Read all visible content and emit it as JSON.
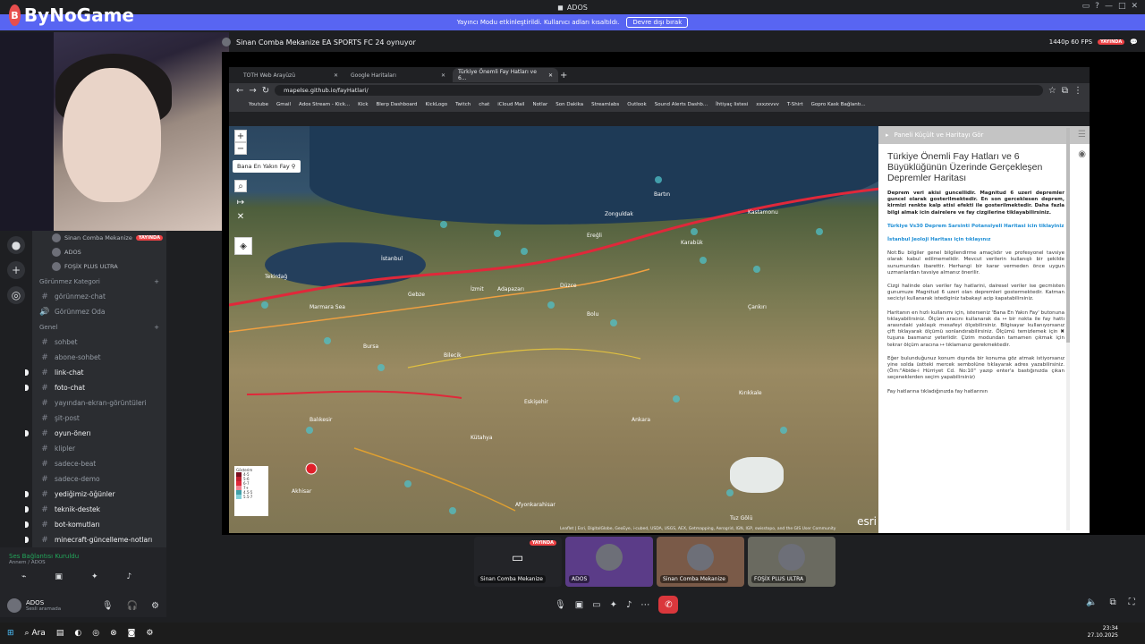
{
  "window": {
    "title": "ADOS"
  },
  "banner": {
    "text": "Yayıncı Modu etkinleştirildi. Kullanıcı adları kısaltıldı.",
    "button": "Devre dışı bırak"
  },
  "logo": {
    "text": "ByNoGame"
  },
  "voice_users": [
    {
      "name": "Sinan Comba Mekanize",
      "live": "YAYINDA"
    },
    {
      "name": "ADOS"
    },
    {
      "name": "FOŞİX PLUS ULTRA"
    }
  ],
  "categories": {
    "hidden": "Görünmez Kategori",
    "general": "Genel"
  },
  "hidden_channels": [
    "görünmez-chat",
    "Görünmez Oda"
  ],
  "channels": [
    "sohbet",
    "abone-sohbet",
    "link-chat",
    "foto-chat",
    "yayından-ekran-görüntüleri",
    "şit-post",
    "oyun-önerı",
    "klipler",
    "sadece-beat",
    "sadece-demo",
    "yediğimiz-öğünler",
    "teknik-destek",
    "bot-komutları",
    "minecraft-güncelleme-notları"
  ],
  "unread_channels": [
    "link-chat",
    "foto-chat",
    "oyun-önerı",
    "yediğimiz-öğünler",
    "teknik-destek",
    "bot-komutları",
    "minecraft-güncelleme-notları"
  ],
  "voice_status": {
    "title": "Ses Bağlantısı Kuruldu",
    "sub": "Annem / ADOS"
  },
  "user": {
    "name": "ADOS",
    "status": "Sesli aramada"
  },
  "stream": {
    "title": "Sinan Comba Mekanize EA SPORTS FC 24 oynuyor",
    "quality": "1440p 60 FPS",
    "live": "YAYINDA"
  },
  "browser": {
    "tabs": [
      "TOTH Web Arayüzü",
      "Google Haritaları",
      "Türkiye Önemli Fay Hatları ve 6..."
    ],
    "url": "mapelse.github.io/fayHatlari/",
    "bookmarks": [
      "Youtube",
      "Gmail",
      "Ados Stream - Kick...",
      "Kick",
      "Blerp Dashboard",
      "KickLogo",
      "Twitch",
      "chat",
      "iCloud Mail",
      "Notlar",
      "Son Dakika",
      "Streamlabs",
      "Outlook",
      "Sound Alerts Dashb...",
      "İhtiyaç listesi",
      "xxxzxvvv",
      "T-Shirt",
      "Gopro Kask Bağlantı..."
    ]
  },
  "map": {
    "near_button": "Bana En Yakın Fay",
    "attribution": "Leaflet | Esri, DigitalGlobe, GeoEye, i-cubed, USDA, USGS, AEX, Getmapping, Aerogrid, IGN, IGP, swisstopo, and the GIS User Community",
    "esri": "esri",
    "legend_title": "Gösterim",
    "legend_items": [
      "4-5",
      "5-6",
      "6-7",
      "7+",
      "4.5-5",
      "5.5-7"
    ],
    "cities": [
      "Bartın",
      "Zonguldak",
      "Kastamonu",
      "Ereğli",
      "Karabük",
      "İstanbul",
      "Tekirdağ",
      "Gebze",
      "İzmit",
      "Adapazarı",
      "Düzce",
      "Bolu",
      "Çankırı",
      "Bursa",
      "Bilecik",
      "Kütahya",
      "Eskişehir",
      "Ankara",
      "Kırıkkale",
      "Balıkesir",
      "Akhisar",
      "Afyonkarahisar",
      "Tuz Gölü",
      "Marmara Sea"
    ]
  },
  "panel": {
    "header": "Paneli Küçült ve Haritayı Gör",
    "title": "Türkiye Önemli Fay Hatları ve 6 Büyüklüğünün Üzerinde Gerçekleşen Depremler Haritası",
    "note_bold": "Deprem veri akisi guncellidir. Magnitud 6 uzeri depremler guncel olarak gosterilmektedir. En son gerceklesen deprem, kirmizi renkte kalp atisi efekti ile gosterilmektedir. Daha fazla bilgi almak icin dairelere ve fay cizgilerine tiklayabilirsiniz.",
    "link1": "Türkiye Vs30 Deprem Sarsinti Potansiyeli Haritasi icin tiklayiniz",
    "link2": "İstanbul Jeoloji Haritası için tıklayınız",
    "p1": "Not:Bu bilgiler genel bilgilendirme amaçlıdır ve profesyonel tavsiye olarak kabul edilmemelidir. Mevcut verilerin kullanışlı bir şekilde sunumundan ibarettir. Herhangi bir karar vermeden önce uygun uzmanlardan tavsiye almanız önerilir.",
    "p2": "Cizgi halinde olan veriler fay hatlarini, dairesel veriler ise gecmisten gunumuze Magnitud 6 uzeri olan depremleri gostermektedir. Katman seciciyi kullanarak istediginiz tabakayi acip kapatabilirsiniz.",
    "p3": "Haritanın en hızlı kullanımı için, isterseniz 'Bana En Yakın Fay' butonuna tıklayabilirsiniz. Ölçüm aracını kullanarak da ↦ bir nokta ile fay hattı arasındaki yaklaşık mesafeyi ölçebilirsiniz. Bilgisayar kullanıyorsanız çift tıklayarak ölçümü sonlandırabilirsiniz. Ölçümü temizlemek için ✖ tuşuna basmanız yeterlidir. Çizim modundan tamamen çıkmak için tekrar ölçüm aracına ↦ tıklamanız gerekmektedir.",
    "p4": "Eğer bulunduğunuz konum dışında bir konuma göz atmak istiyorsanız yine solda üstteki mercek sembolüne tıklayarak adres yazabilirsiniz. (Örn:\"Abide-i Hürriyet Cd. No:10\" yazıp enter'a bastığınızda çıkan seçeneklerden seçim yapabilirsiniz)",
    "p5": "Fay hatlarına tıkladığınızda fay hatlarının"
  },
  "stage": {
    "tiles": [
      "Sinan Comba Mekanize",
      "ADOS",
      "Sinan Comba Mekanize",
      "FOŞİX PLUS ULTRA"
    ],
    "live": "YAYINDA"
  },
  "taskbar": {
    "search": "Ara",
    "time": "23:34",
    "date": "27.10.2025"
  },
  "colors": {
    "accent": "#5865f2",
    "live": "#ed4245",
    "fault": "#e0283a",
    "quake": "#4fc0c8"
  }
}
